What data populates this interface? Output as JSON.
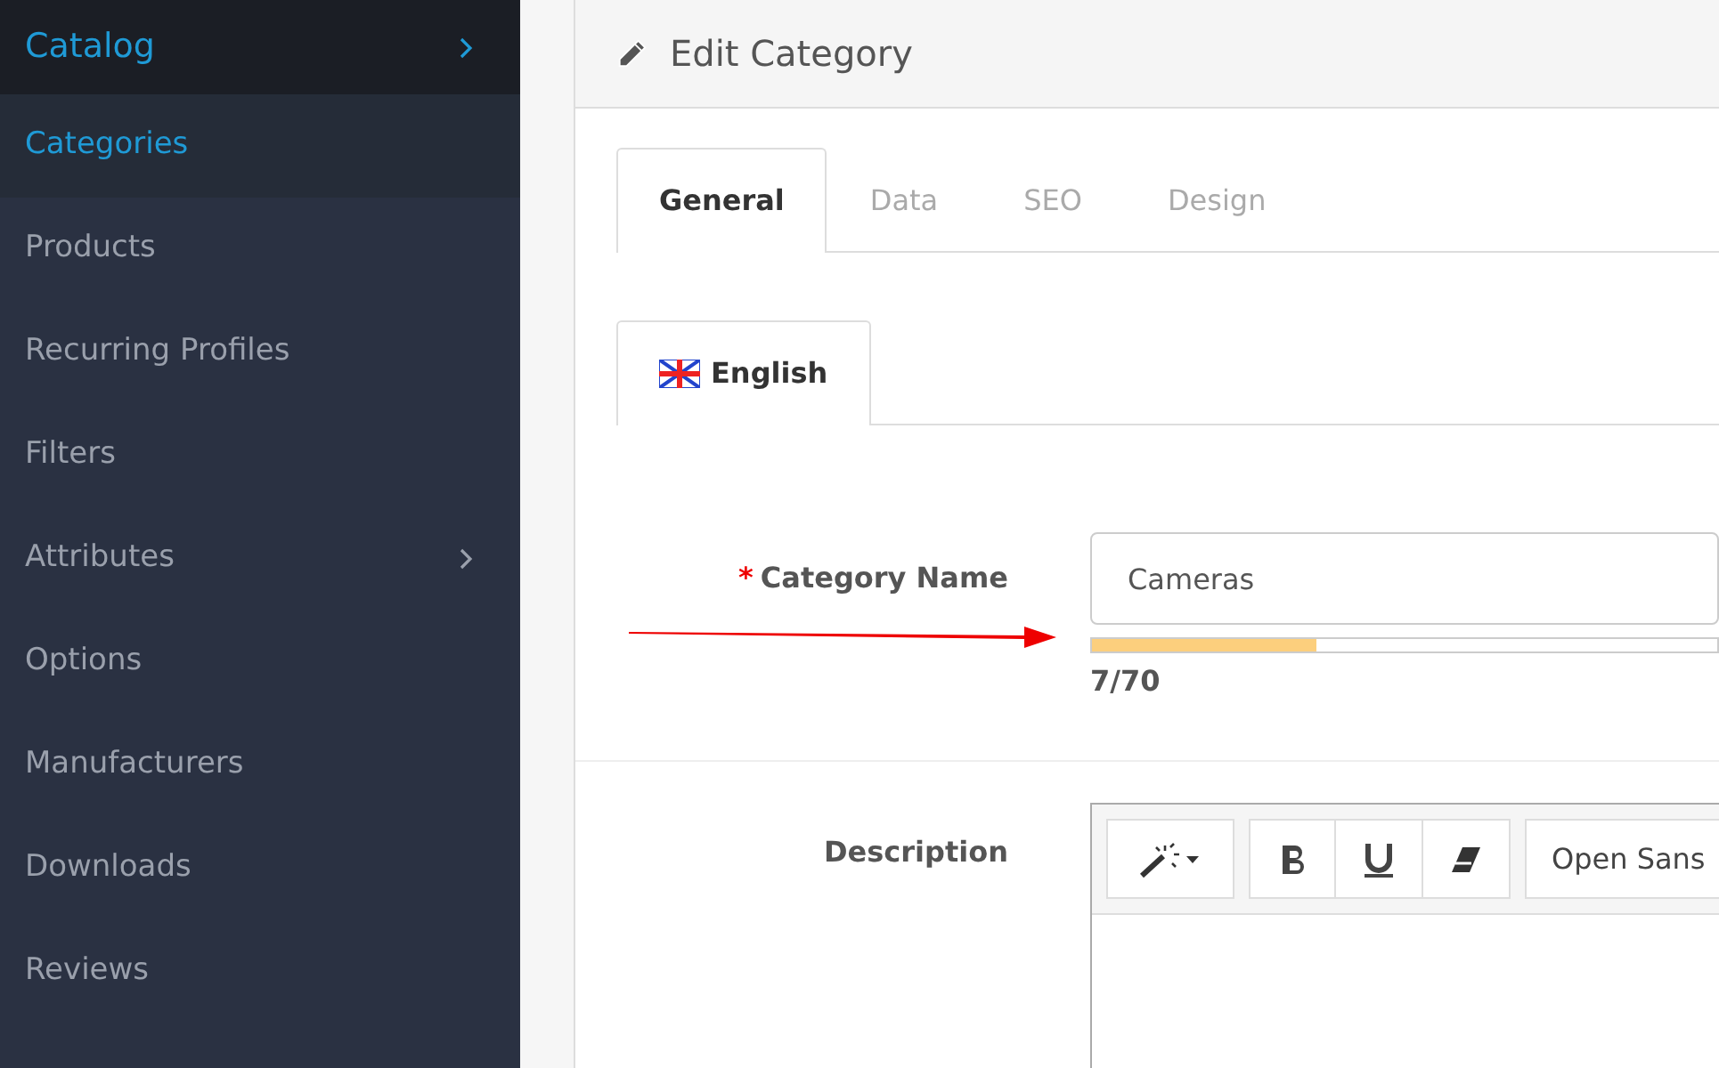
{
  "sidebar": {
    "items": [
      {
        "label": "Catalog",
        "selected": false,
        "has_submenu": true,
        "kind": "parent"
      },
      {
        "label": "Categories",
        "selected": true,
        "has_submenu": false,
        "kind": "child"
      },
      {
        "label": "Products",
        "selected": false,
        "has_submenu": false,
        "kind": "child"
      },
      {
        "label": "Recurring Profiles",
        "selected": false,
        "has_submenu": false,
        "kind": "child"
      },
      {
        "label": "Filters",
        "selected": false,
        "has_submenu": false,
        "kind": "child"
      },
      {
        "label": "Attributes",
        "selected": false,
        "has_submenu": true,
        "kind": "child"
      },
      {
        "label": "Options",
        "selected": false,
        "has_submenu": false,
        "kind": "child"
      },
      {
        "label": "Manufacturers",
        "selected": false,
        "has_submenu": false,
        "kind": "child"
      },
      {
        "label": "Downloads",
        "selected": false,
        "has_submenu": false,
        "kind": "child"
      },
      {
        "label": "Reviews",
        "selected": false,
        "has_submenu": false,
        "kind": "child"
      }
    ]
  },
  "panel": {
    "title": "Edit Category",
    "tabs": [
      {
        "label": "General",
        "selected": true
      },
      {
        "label": "Data",
        "selected": false
      },
      {
        "label": "SEO",
        "selected": false
      },
      {
        "label": "Design",
        "selected": false
      }
    ],
    "language_tabs": [
      {
        "label": "English",
        "selected": true
      }
    ],
    "category_name": {
      "label": "Category Name",
      "required": true,
      "required_mark": "*",
      "value": "Cameras",
      "level": 0.36,
      "counter": "7/70"
    },
    "description": {
      "label": "Description",
      "font_select": "Open Sans"
    }
  }
}
